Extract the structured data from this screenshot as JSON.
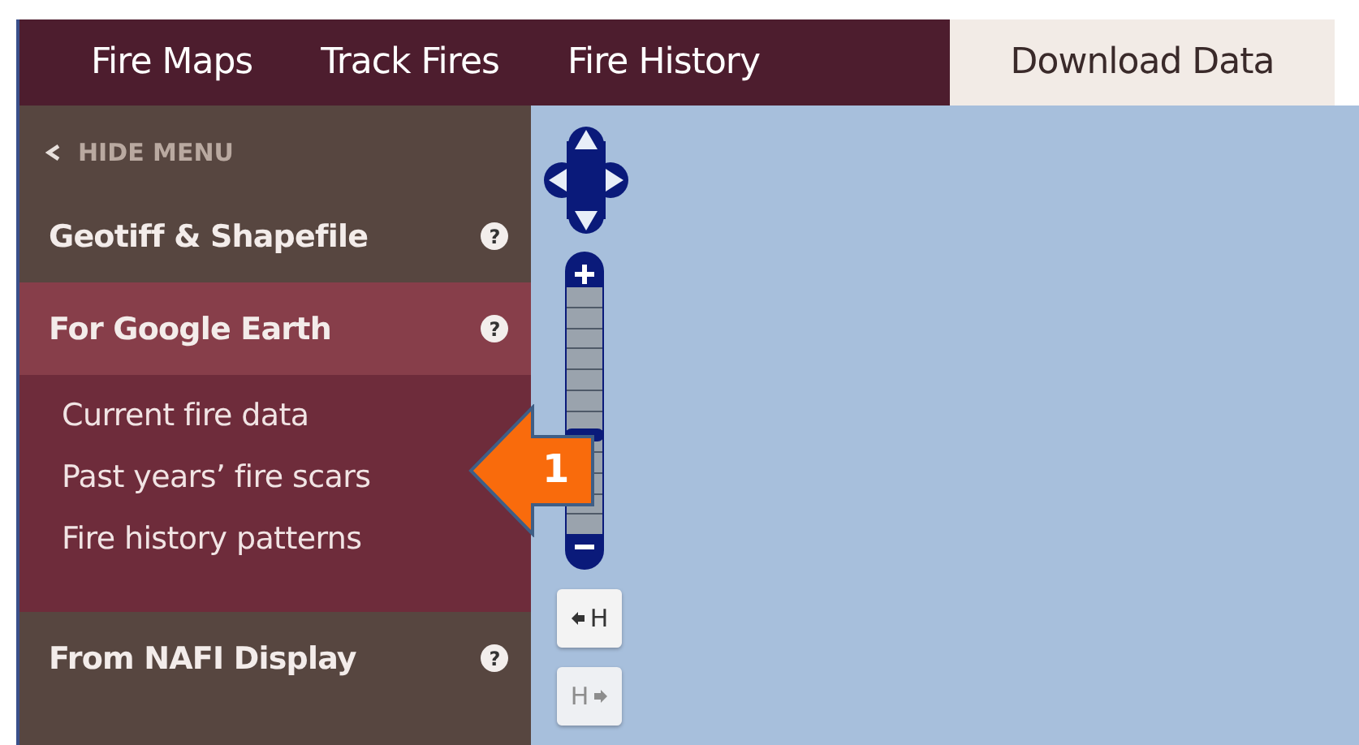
{
  "tabs": [
    {
      "label": "Fire Maps",
      "selected": false
    },
    {
      "label": "Track Fires",
      "selected": false
    },
    {
      "label": "Fire History",
      "selected": false
    },
    {
      "label": "Download Data",
      "selected": true
    }
  ],
  "sidebar": {
    "hide_menu": "HIDE MENU",
    "sections": [
      {
        "label": "Geotiff & Shapefile",
        "help": "?",
        "expanded": false
      },
      {
        "label": "For Google Earth",
        "help": "?",
        "expanded": true,
        "children": [
          {
            "label": "Current fire data"
          },
          {
            "label": "Past years’ fire scars"
          },
          {
            "label": "Fire history patterns"
          }
        ]
      },
      {
        "label": "From NAFI Display",
        "help": "?",
        "expanded": false
      }
    ]
  },
  "map": {
    "zoom": {
      "level": 0.4
    },
    "layer_buttons": [
      {
        "label": "H",
        "kind": "left",
        "disabled": false
      },
      {
        "label": "H",
        "kind": "right",
        "disabled": true
      }
    ]
  },
  "callout": {
    "label": "1"
  }
}
